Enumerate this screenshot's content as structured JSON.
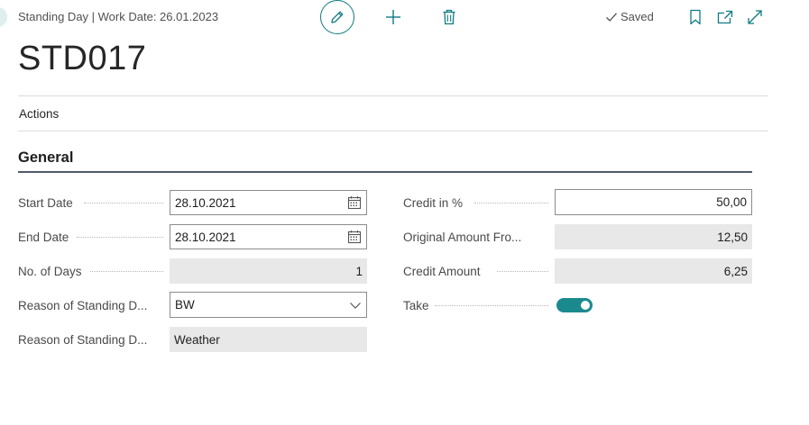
{
  "header": {
    "breadcrumb": "Standing Day | Work Date: 26.01.2023",
    "saved_label": "Saved"
  },
  "page": {
    "title": "STD017"
  },
  "actions_label": "Actions",
  "general": {
    "title": "General",
    "left_fields": [
      {
        "label": "Start Date",
        "value": "28.10.2021"
      },
      {
        "label": "End Date",
        "value": "28.10.2021"
      },
      {
        "label": "No. of Days",
        "value": "1"
      },
      {
        "label": "Reason of Standing D...",
        "value": "BW"
      },
      {
        "label": "Reason of Standing D...",
        "value": "Weather"
      }
    ],
    "right_fields": [
      {
        "label": "Credit in %",
        "value": "50,00"
      },
      {
        "label": "Original Amount Fro...",
        "value": "12,50"
      },
      {
        "label": "Credit Amount",
        "value": "6,25"
      },
      {
        "label": "Take",
        "value": "on"
      }
    ]
  },
  "icons": {
    "edit": "pencil-icon",
    "new": "plus-icon",
    "delete": "trash-icon",
    "saved": "checkmark-icon",
    "bookmark": "bookmark-icon",
    "open_new_window": "open-in-new-window-icon",
    "expand": "expand-icon",
    "calendar": "calendar-icon",
    "dropdown": "chevron-down-icon"
  },
  "colors": {
    "accent": "#0f7b82",
    "toggle_on": "#1b8a8f",
    "readonly_bg": "#e8e8e8",
    "section_rule": "#505a6a"
  }
}
